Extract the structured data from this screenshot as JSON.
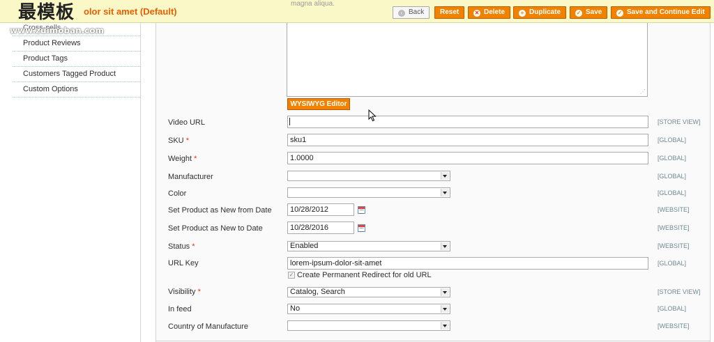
{
  "header": {
    "title": "olor sit amet (Default)",
    "faded_text": "magna aliqua.",
    "watermark": "最模板",
    "watermark_url": "www.zuimoban.com",
    "buttons": {
      "back": "Back",
      "reset": "Reset",
      "delete": "Delete",
      "duplicate": "Duplicate",
      "save": "Save",
      "save_continue": "Save and Continue Edit"
    }
  },
  "sidebar": {
    "items": [
      {
        "label": "Cross-sells"
      },
      {
        "label": "Product Reviews"
      },
      {
        "label": "Product Tags"
      },
      {
        "label": "Customers Tagged Product"
      },
      {
        "label": "Custom Options"
      }
    ]
  },
  "editor": {
    "wysiwyg_label": "WYSIWYG Editor"
  },
  "form": {
    "video_url": {
      "label": "Video URL",
      "value": "",
      "scope": "[STORE VIEW]"
    },
    "sku": {
      "label": "SKU",
      "value": "sku1",
      "scope": "[GLOBAL]"
    },
    "weight": {
      "label": "Weight",
      "value": "1.0000",
      "scope": "[GLOBAL]"
    },
    "manufacturer": {
      "label": "Manufacturer",
      "value": "",
      "scope": "[GLOBAL]"
    },
    "color": {
      "label": "Color",
      "value": "",
      "scope": "[GLOBAL]"
    },
    "new_from": {
      "label": "Set Product as New from Date",
      "value": "10/28/2012",
      "scope": "[WEBSITE]"
    },
    "new_to": {
      "label": "Set Product as New to Date",
      "value": "10/28/2016",
      "scope": "[WEBSITE]"
    },
    "status": {
      "label": "Status",
      "value": "Enabled",
      "scope": "[WEBSITE]"
    },
    "url_key": {
      "label": "URL Key",
      "value": "lorem-ipsum-dolor-sit-amet",
      "scope": "[GLOBAL]",
      "redirect_label": "Create Permanent Redirect for old URL"
    },
    "visibility": {
      "label": "Visibility",
      "value": "Catalog, Search",
      "scope": "[STORE VIEW]"
    },
    "in_feed": {
      "label": "In feed",
      "value": "No",
      "scope": "[GLOBAL]"
    },
    "country": {
      "label": "Country of Manufacture",
      "value": "",
      "scope": "[WEBSITE]"
    }
  },
  "colors": {
    "accent": "#f18200",
    "title": "#eb5e00",
    "header_bg": "#fbf8c8",
    "required": "#eb340a"
  }
}
